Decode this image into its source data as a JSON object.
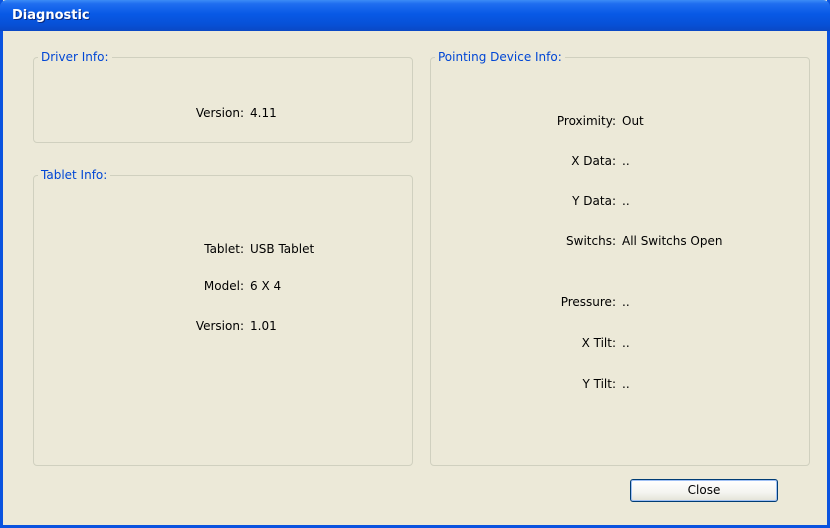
{
  "window": {
    "title": "Diagnostic"
  },
  "driver_info": {
    "legend": "Driver Info:",
    "version_label": "Version:",
    "version_value": "4.11"
  },
  "tablet_info": {
    "legend": "Tablet Info:",
    "rows": [
      {
        "label": "Tablet:",
        "value": "USB Tablet"
      },
      {
        "label": "Model:",
        "value": "6 X 4"
      },
      {
        "label": "Version:",
        "value": "1.01"
      }
    ]
  },
  "pointing_device_info": {
    "legend": "Pointing Device Info:",
    "rows": [
      {
        "label": "Proximity:",
        "value": "Out"
      },
      {
        "label": "X Data:",
        "value": ".."
      },
      {
        "label": "Y Data:",
        "value": ".."
      },
      {
        "label": "Switchs:",
        "value": "All Switchs Open"
      },
      {
        "label": "Pressure:",
        "value": ".."
      },
      {
        "label": "X Tilt:",
        "value": ".."
      },
      {
        "label": "Y Tilt:",
        "value": ".."
      }
    ]
  },
  "buttons": {
    "close_label": "Close"
  }
}
